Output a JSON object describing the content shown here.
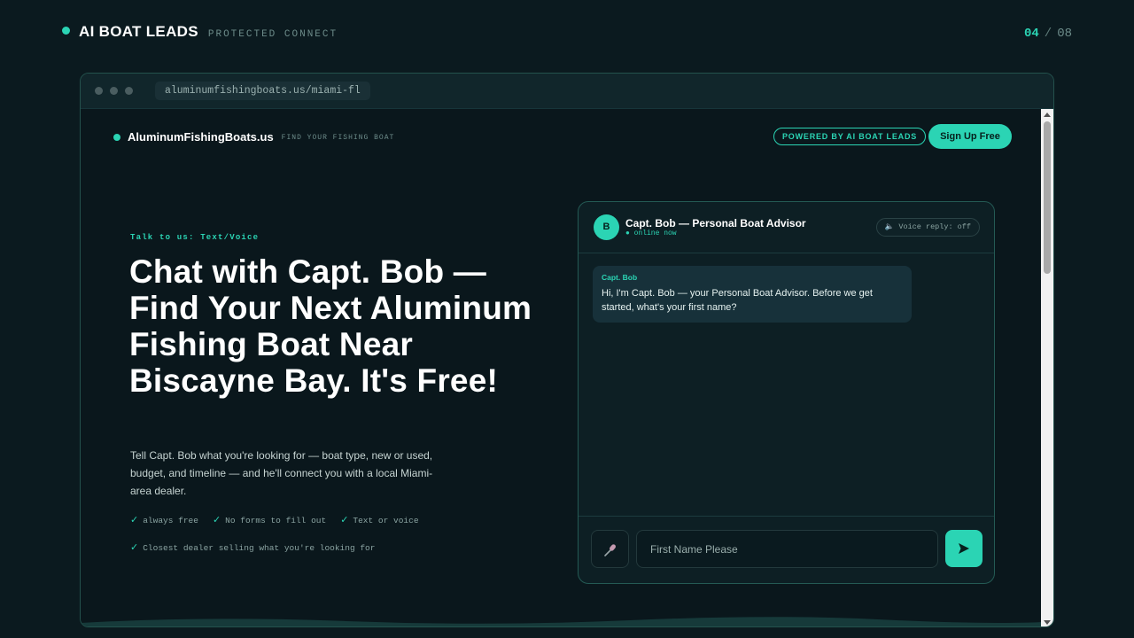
{
  "header": {
    "brand": "AI BOAT LEADS",
    "subtitle": "PROTECTED CONNECT",
    "page_current": "04",
    "page_sep": "/",
    "page_total": "08"
  },
  "browser": {
    "url": "aluminumfishingboats.us/miami-fl"
  },
  "site": {
    "name": "AluminumFishingBoats.us",
    "tagline": "FIND YOUR FISHING BOAT",
    "powered_badge": "POWERED BY AI BOAT LEADS",
    "signup_label": "Sign Up Free"
  },
  "hero": {
    "eyebrow": "Talk to us: Text/Voice",
    "title": "Chat with Capt. Bob — Find Your Next Aluminum Fishing Boat Near Biscayne Bay. It's Free!",
    "description": "Tell Capt. Bob what you're looking for — boat type, new or used, budget, and timeline — and he'll connect you with a local Miami-area dealer.",
    "checks": [
      "always free",
      "No forms to fill out",
      "Text or voice",
      "Closest dealer selling what you're looking for"
    ],
    "check_mark": "✓"
  },
  "chat": {
    "avatar_letter": "B",
    "advisor_name": "Capt. Bob — Personal Boat Advisor",
    "status": "● online now",
    "voice_reply": "🔈 Voice reply: off",
    "message_from": "Capt. Bob",
    "message_text": "Hi, I'm Capt. Bob — your Personal Boat Advisor. Before we get started, what's your first name?",
    "input_placeholder": "First Name Please",
    "mic_icon": "mic-icon",
    "send_icon": "send-icon"
  },
  "colors": {
    "accent": "#2bd4b4",
    "background": "#0b1a1f"
  }
}
